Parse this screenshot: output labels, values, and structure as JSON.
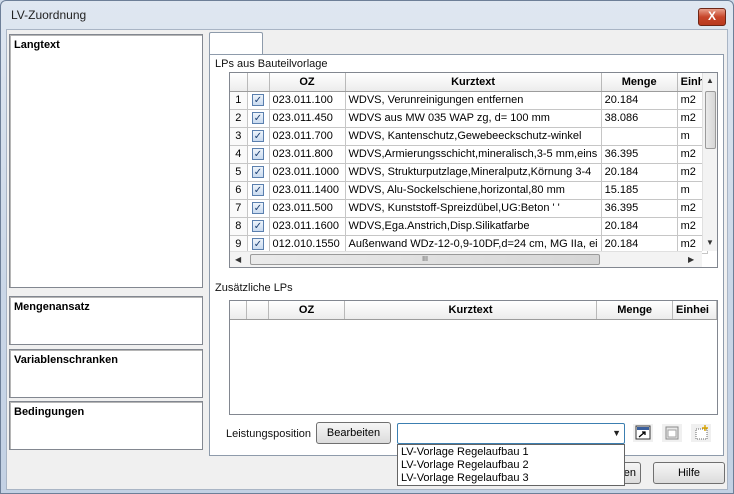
{
  "window": {
    "title": "LV-Zuordnung",
    "close_label": "X"
  },
  "left_panel": {
    "langtext_label": "Langtext",
    "mengenansatz_label": "Mengenansatz",
    "variablenschranken_label": "Variablenschranken",
    "bedingungen_label": "Bedingungen"
  },
  "main": {
    "lps_section_label": "LPs aus Bauteilvorlage",
    "zusaetzliche_section_label": "Zusätzliche LPs",
    "columns": {
      "oz": "OZ",
      "kurztext": "Kurztext",
      "menge": "Menge",
      "einheit_truncated": "Einh",
      "einheit_truncated2": "Einhei"
    },
    "rows": [
      {
        "num": "1",
        "checked": true,
        "oz": "023.011.100",
        "kurztext": "WDVS, Verunreinigungen entfernen",
        "menge": "20.184",
        "einheit": "m2"
      },
      {
        "num": "2",
        "checked": true,
        "oz": "023.011.450",
        "kurztext": "WDVS aus MW 035 WAP zg, d= 100 mm",
        "menge": "38.086",
        "einheit": "m2"
      },
      {
        "num": "3",
        "checked": true,
        "oz": "023.011.700",
        "kurztext": "WDVS, Kantenschutz,Gewebeeckschutz-winkel",
        "menge": "",
        "einheit": "m"
      },
      {
        "num": "4",
        "checked": true,
        "oz": "023.011.800",
        "kurztext": "WDVS,Armierungsschicht,mineralisch,3-5 mm,eins",
        "menge": "36.395",
        "einheit": "m2"
      },
      {
        "num": "5",
        "checked": true,
        "oz": "023.011.1000",
        "kurztext": "WDVS, Strukturputzlage,Mineralputz,Körnung 3-4",
        "menge": "20.184",
        "einheit": "m2"
      },
      {
        "num": "6",
        "checked": true,
        "oz": "023.011.1400",
        "kurztext": "WDVS, Alu-Sockelschiene,horizontal,80 mm",
        "menge": "15.185",
        "einheit": "m"
      },
      {
        "num": "7",
        "checked": true,
        "oz": "023.011.500",
        "kurztext": "WDVS, Kunststoff-Spreizdübel,UG:Beton ' '",
        "menge": "36.395",
        "einheit": "m2"
      },
      {
        "num": "8",
        "checked": true,
        "oz": "023.011.1600",
        "kurztext": "WDVS,Ega.Anstrich,Disp.Silikatfarbe",
        "menge": "20.184",
        "einheit": "m2"
      },
      {
        "num": "9",
        "checked": true,
        "oz": "012.010.1550",
        "kurztext": "Außenwand WDz-12-0,9-10DF,d=24 cm, MG IIa, ei",
        "menge": "20.184",
        "einheit": "m2"
      }
    ],
    "hscroll_grip": "III",
    "leistungsposition_label": "Leistungsposition",
    "bearbeiten_label": "Bearbeiten",
    "combo_value": "",
    "dropdown_options": [
      "LV-Vorlage Regelaufbau 1",
      "LV-Vorlage Regelaufbau 2",
      "LV-Vorlage Regelaufbau 3"
    ]
  },
  "footer": {
    "partial_button_label": "en",
    "hilfe_label": "Hilfe"
  }
}
